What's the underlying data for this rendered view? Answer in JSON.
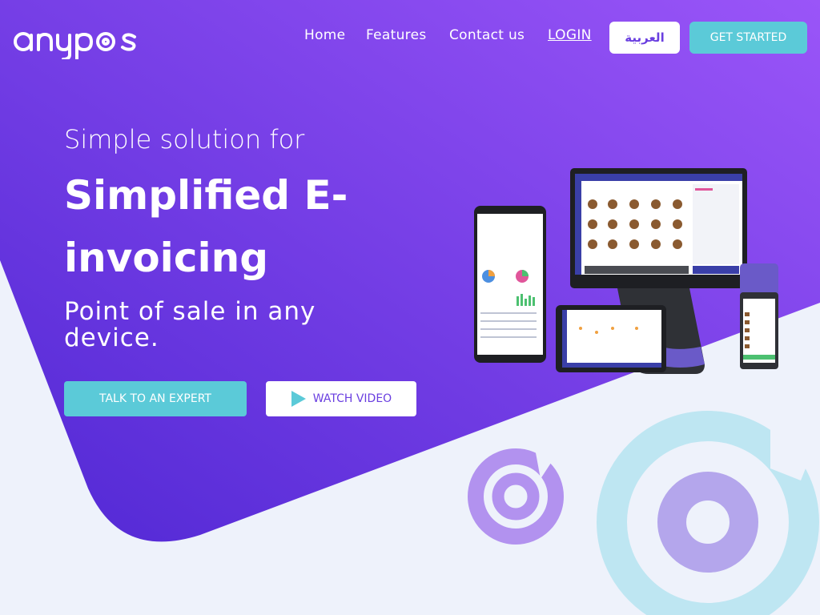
{
  "brand": {
    "logo_text": "anypos"
  },
  "nav": {
    "links": [
      {
        "label": "Home"
      },
      {
        "label": "Features"
      },
      {
        "label": "Contact us"
      },
      {
        "label": "LOGIN"
      }
    ],
    "arabic_label": "العربية",
    "get_started_label": "GET STARTED"
  },
  "hero": {
    "pre_title": "Simple solution for",
    "title": "Simplified E-invoicing",
    "subtitle": "Point of sale in any device.",
    "cta_primary": "TALK TO AN EXPERT",
    "cta_secondary": "WATCH VIDEO",
    "cta_secondary_icon": "play-icon"
  },
  "colors": {
    "hero_gradient_start": "#5a2fd8",
    "hero_gradient_end": "#9a55f5",
    "accent_teal": "#5bcad8",
    "brand_purple": "#6a3fe0",
    "page_background": "#eef2fb"
  }
}
